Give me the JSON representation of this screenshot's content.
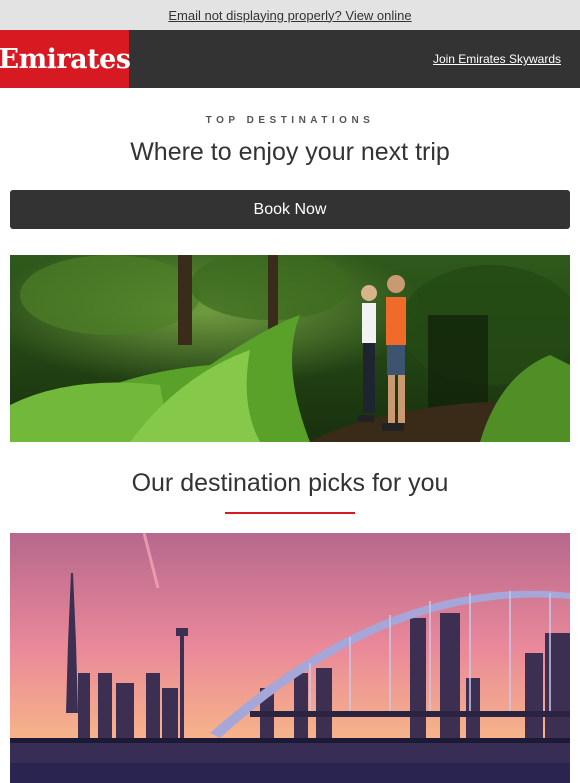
{
  "topbar": {
    "view_online": "Email not displaying properly? View online"
  },
  "header": {
    "logo_text": "Emirates",
    "join_link": "Join Emirates Skywards"
  },
  "intro": {
    "eyebrow": "TOP DESTINATIONS",
    "title": "Where to enjoy your next trip",
    "cta": "Book Now"
  },
  "picks": {
    "title": "Our destination picks for you"
  },
  "colors": {
    "brand_red": "#d71921",
    "dark": "#333333",
    "topbar_bg": "#e3e3e3"
  }
}
